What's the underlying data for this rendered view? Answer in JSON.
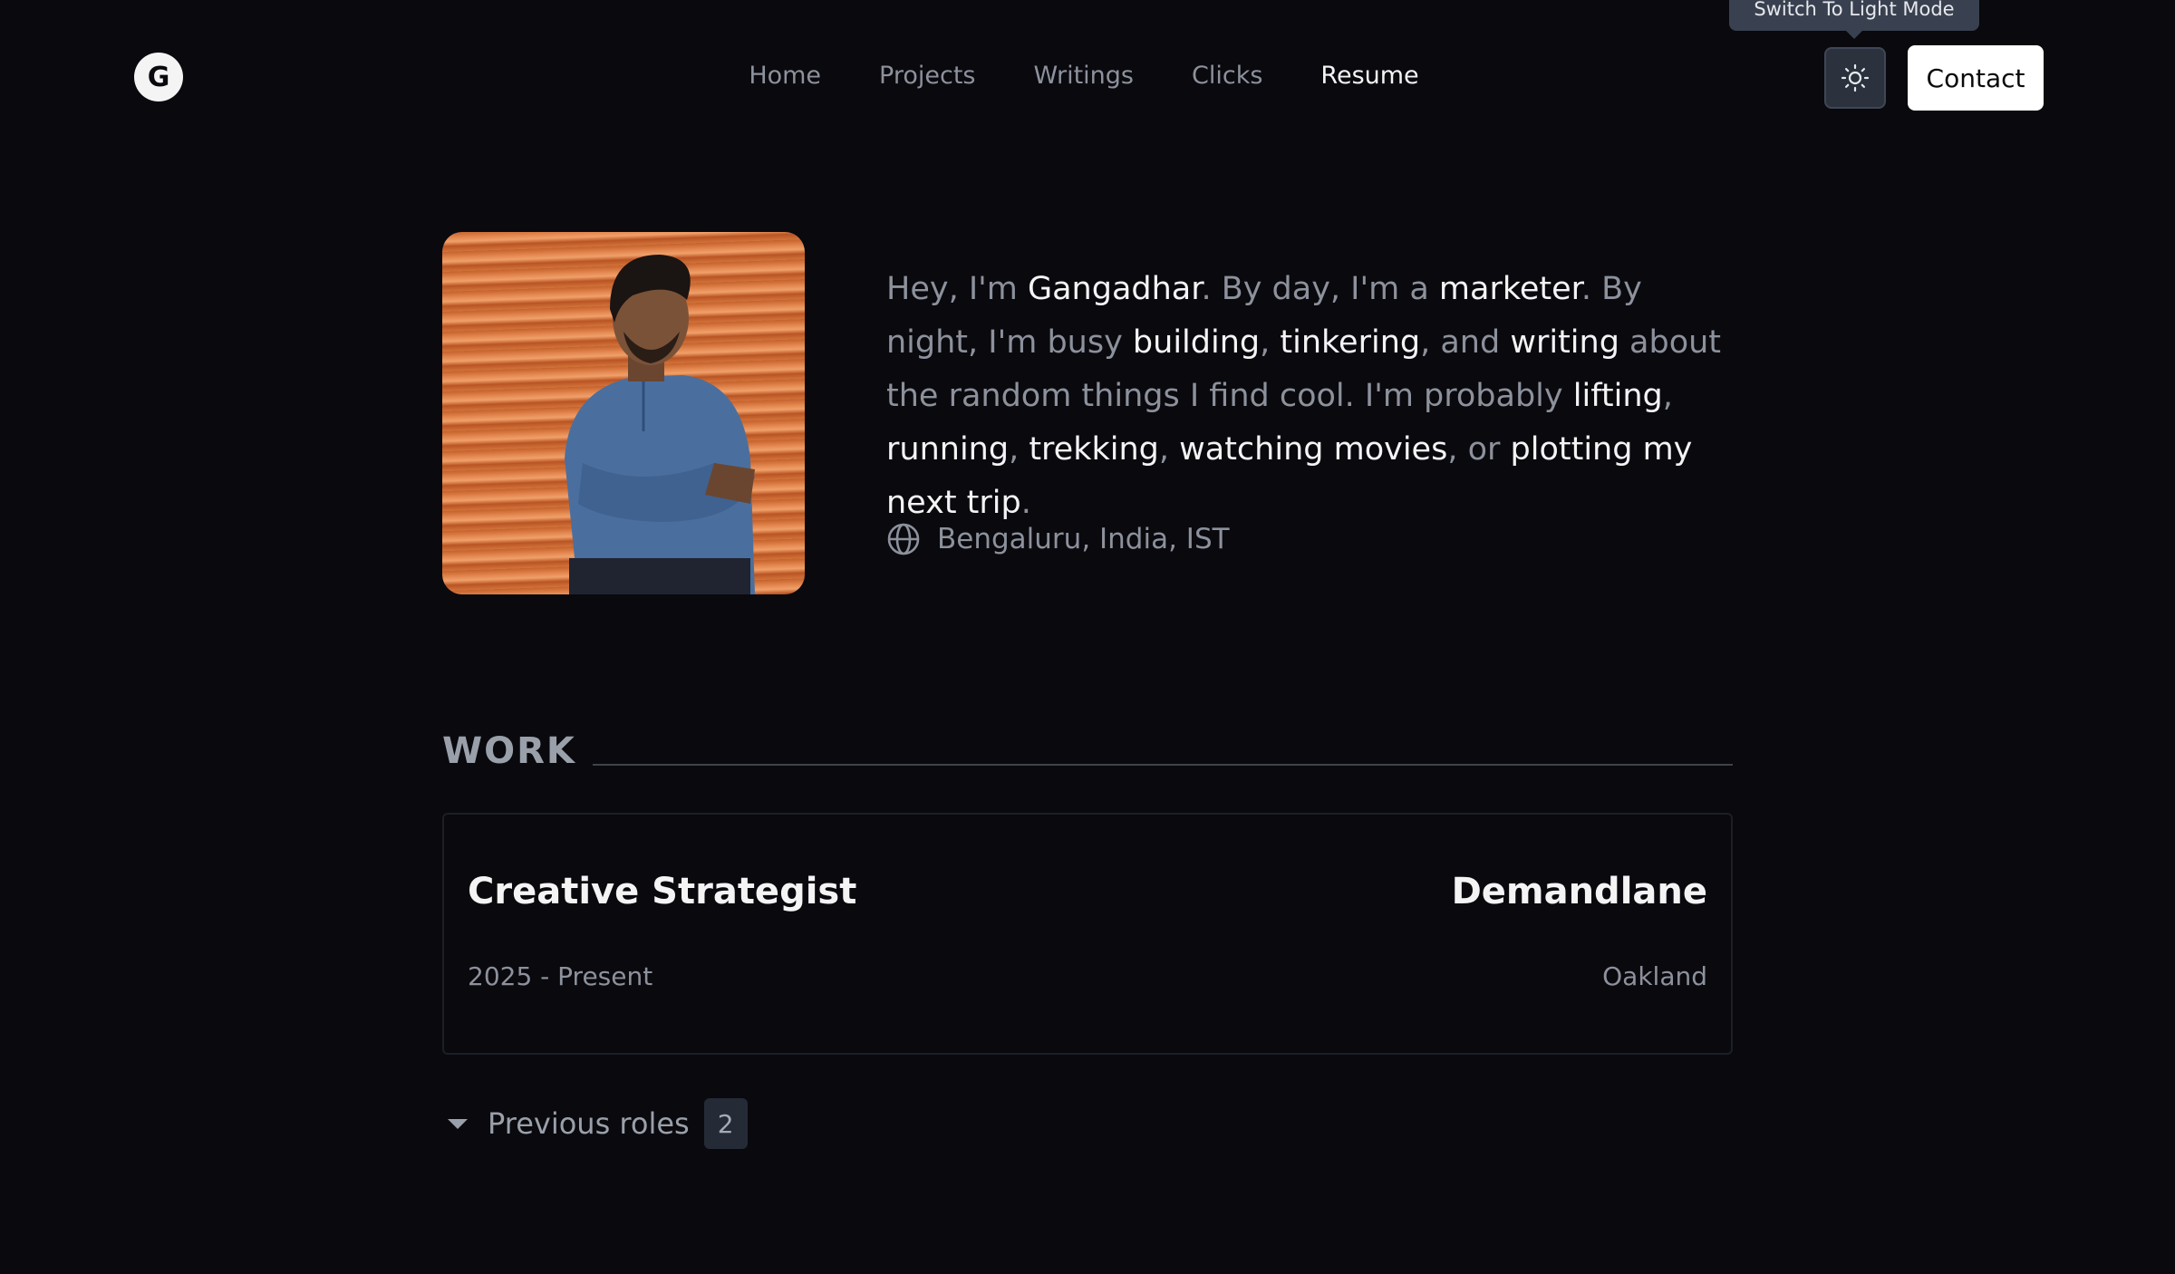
{
  "header": {
    "logo_letter": "G",
    "nav": [
      {
        "label": "Home"
      },
      {
        "label": "Projects"
      },
      {
        "label": "Writings"
      },
      {
        "label": "Clicks"
      },
      {
        "label": "Resume",
        "active": true
      }
    ],
    "theme_tooltip": "Switch To Light Mode",
    "theme_icon": "sun-icon",
    "contact_label": "Contact"
  },
  "hero": {
    "bio": {
      "p1": "Hey, I'm ",
      "name": "Gangadhar",
      "p2": ". By day, I'm a ",
      "role": "marketer",
      "p3": ". By night, I'm busy ",
      "h_building": "building",
      "sep1": ", ",
      "h_tinkering": "tinkering",
      "p4": ", and ",
      "h_writing": "writing",
      "p5": " about the random things I find cool. I'm probably ",
      "h_lifting": "lifting",
      "sep2": ", ",
      "h_running": "running",
      "sep3": ", ",
      "h_trekking": "trekking",
      "sep4": ", ",
      "h_movies": "watching movies",
      "p6": ", or ",
      "h_trip": "plotting my next trip",
      "p7": "."
    },
    "location": "Bengaluru, India, IST",
    "location_icon": "globe-icon"
  },
  "work": {
    "heading": "WORK",
    "current": {
      "title": "Creative Strategist",
      "company": "Demandlane",
      "period": "2025 - Present",
      "location": "Oakland"
    },
    "previous_label": "Previous roles",
    "previous_count": "2"
  },
  "colors": {
    "background": "#09090e",
    "text_muted": "#8c919c",
    "text_highlight": "#f4f4f5",
    "tooltip_bg": "#394150"
  }
}
